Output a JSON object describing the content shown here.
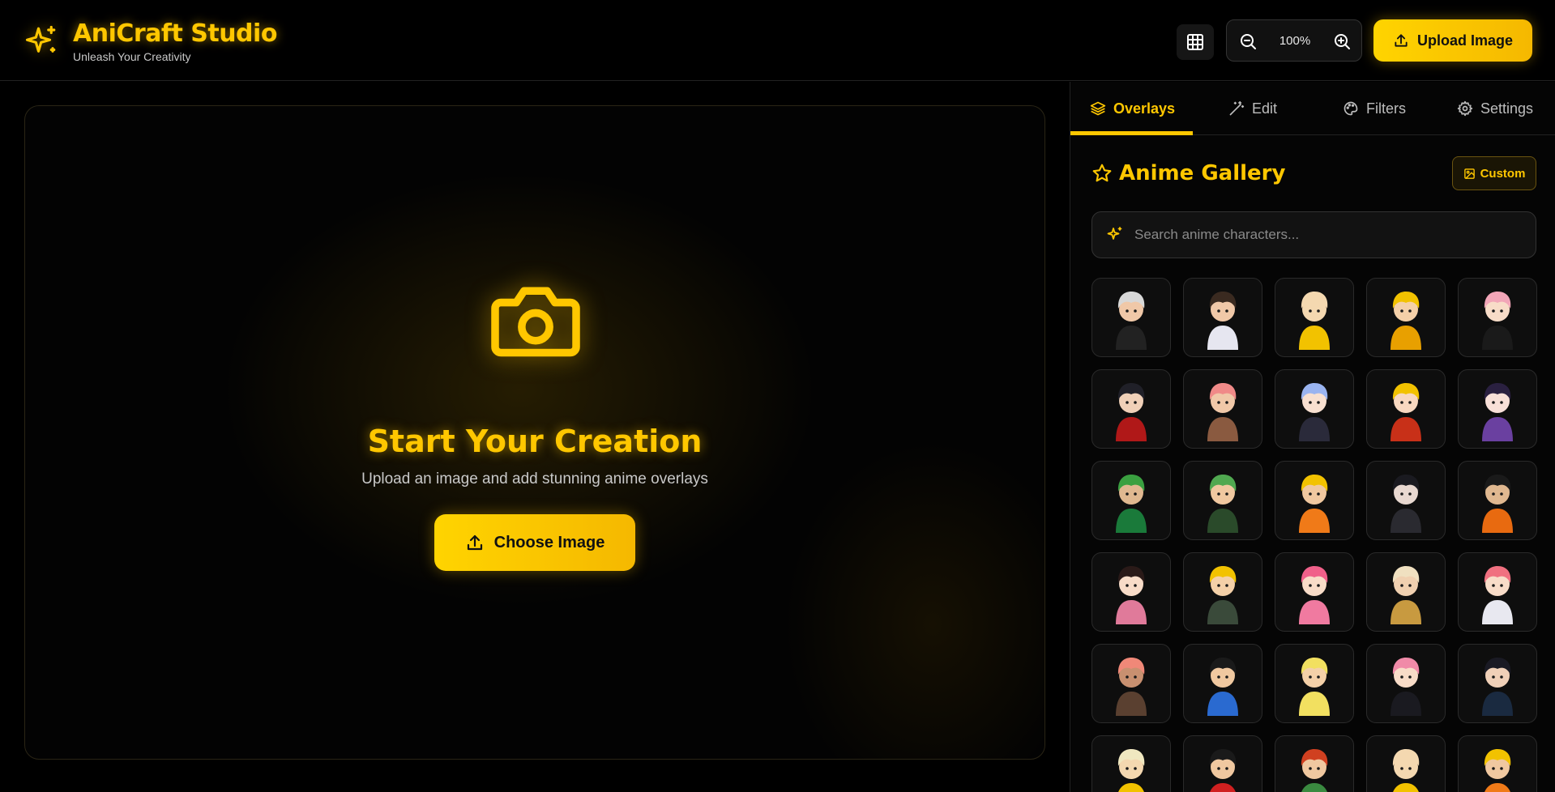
{
  "header": {
    "title": "AniCraft Studio",
    "subtitle": "Unleash Your Creativity",
    "zoom_level": "100%",
    "upload_label": "Upload Image"
  },
  "canvas": {
    "title": "Start Your Creation",
    "subtitle": "Upload an image and add stunning anime overlays",
    "choose_label": "Choose Image"
  },
  "tabs": [
    {
      "label": "Overlays",
      "icon": "layers-icon"
    },
    {
      "label": "Edit",
      "icon": "magic-wand-icon"
    },
    {
      "label": "Filters",
      "icon": "palette-icon"
    },
    {
      "label": "Settings",
      "icon": "gear-icon"
    }
  ],
  "gallery": {
    "title": "Anime Gallery",
    "custom_label": "Custom",
    "search_placeholder": "Search anime characters...",
    "items": [
      {
        "hair": "#d8d8d8",
        "skin": "#f0c8a8",
        "outfit": "#222222"
      },
      {
        "hair": "#3a2a20",
        "skin": "#f0c8a8",
        "outfit": "#e6e6f0"
      },
      {
        "hair": "#f4d8b0",
        "skin": "#f4d8b0",
        "outfit": "#f2c200"
      },
      {
        "hair": "#f2c200",
        "skin": "#f4d0a8",
        "outfit": "#e8a000"
      },
      {
        "hair": "#f2a6b8",
        "skin": "#f8dcc8",
        "outfit": "#1a1a1a"
      },
      {
        "hair": "#202028",
        "skin": "#f0d0b8",
        "outfit": "#b01818"
      },
      {
        "hair": "#f08a88",
        "skin": "#f0c8a8",
        "outfit": "#8a5a40"
      },
      {
        "hair": "#9ab4f0",
        "skin": "#f8e0d0",
        "outfit": "#2a2a3a"
      },
      {
        "hair": "#f2c200",
        "skin": "#f8d8c0",
        "outfit": "#c83018"
      },
      {
        "hair": "#2a2040",
        "skin": "#f8e0d8",
        "outfit": "#6a40a0"
      },
      {
        "hair": "#3aa040",
        "skin": "#e0b890",
        "outfit": "#1a7a3a"
      },
      {
        "hair": "#50a850",
        "skin": "#f0c8a0",
        "outfit": "#2a4a2a"
      },
      {
        "hair": "#f2c200",
        "skin": "#f0c8a0",
        "outfit": "#f07a18"
      },
      {
        "hair": "#1a1a20",
        "skin": "#e8d8d0",
        "outfit": "#2a2a30"
      },
      {
        "hair": "#1a1a1a",
        "skin": "#e0b890",
        "outfit": "#e86a10"
      },
      {
        "hair": "#2a1a18",
        "skin": "#f8dcc8",
        "outfit": "#e07a9a"
      },
      {
        "hair": "#f2c200",
        "skin": "#f4d0a8",
        "outfit": "#3a4a3a"
      },
      {
        "hair": "#f0608a",
        "skin": "#f8dcc8",
        "outfit": "#f07aa0"
      },
      {
        "hair": "#f0e0c0",
        "skin": "#f0d0b0",
        "outfit": "#c89a40"
      },
      {
        "hair": "#f07080",
        "skin": "#f8dcc8",
        "outfit": "#e8e8f0"
      },
      {
        "hair": "#f08878",
        "skin": "#c89070",
        "outfit": "#5a4030"
      },
      {
        "hair": "#1a1a1a",
        "skin": "#f0c8a0",
        "outfit": "#2a6ad0"
      },
      {
        "hair": "#f2e060",
        "skin": "#f4d0a8",
        "outfit": "#f2e060"
      },
      {
        "hair": "#f08aa8",
        "skin": "#f8dcc8",
        "outfit": "#1a1a20"
      },
      {
        "hair": "#1a1a24",
        "skin": "#f0d0b8",
        "outfit": "#1a2a40"
      },
      {
        "hair": "#f0e8c0",
        "skin": "#f4d8b0",
        "outfit": "#f2c200"
      },
      {
        "hair": "#1a1a1a",
        "skin": "#f0c8a0",
        "outfit": "#d02020"
      },
      {
        "hair": "#d04020",
        "skin": "#f0c8a0",
        "outfit": "#3a8a40"
      },
      {
        "hair": "#f4d8b0",
        "skin": "#f4d8b0",
        "outfit": "#f2c200"
      },
      {
        "hair": "#f2c200",
        "skin": "#f0c8a0",
        "outfit": "#f07a18"
      }
    ]
  },
  "colors": {
    "accent": "#ffc700",
    "background": "#000000"
  }
}
